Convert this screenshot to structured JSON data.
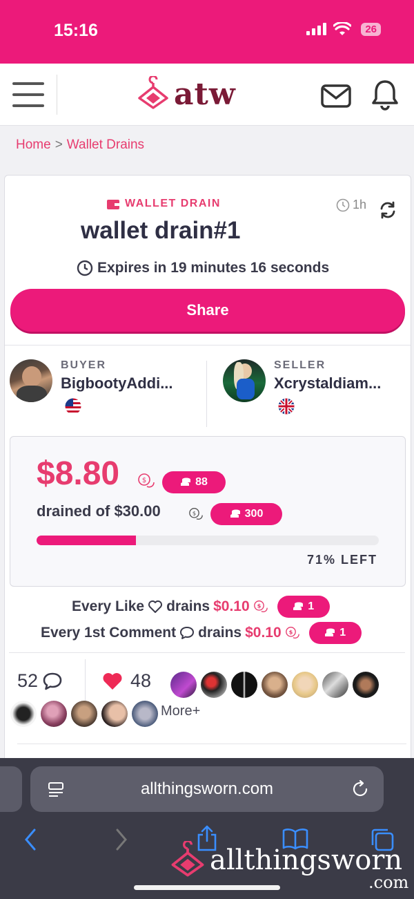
{
  "status": {
    "time": "15:16",
    "battery": "26"
  },
  "header": {
    "logo_text": "atw",
    "menu_icon": "hamburger-icon",
    "mail_icon": "mail-icon",
    "bell_icon": "bell-icon"
  },
  "breadcrumb": {
    "home": "Home",
    "sep": ">",
    "current": "Wallet Drains"
  },
  "listing": {
    "tag": "WALLET DRAIN",
    "title": "wallet drain#1",
    "age": "1h",
    "expires": "Expires in 19 minutes 16 seconds",
    "share_label": "Share"
  },
  "buyer": {
    "role": "BUYER",
    "name": "BigbootyAddi..."
  },
  "seller": {
    "role": "SELLER",
    "name": "Xcrystaldiam..."
  },
  "drain": {
    "amount": "$8.80",
    "amount_tokens": "88",
    "drained_text": "drained of $30.00",
    "total_tokens": "300",
    "progress_drained": 0.29,
    "left_label": "71% LEFT"
  },
  "rules": {
    "like_prefix": "Every Like",
    "like_middle": "drains",
    "like_amount": "$0.10",
    "like_tokens": "1",
    "comment_prefix": "Every 1st Comment",
    "comment_middle": "drains",
    "comment_amount": "$0.10",
    "comment_tokens": "1"
  },
  "stats": {
    "comments": "52",
    "likes": "48",
    "more_label": "More+"
  },
  "browser": {
    "url": "allthingsworn.com"
  },
  "watermark": {
    "text": "allthingsworn",
    "suffix": ".com"
  },
  "colors": {
    "brand_pink": "#ec1a7a",
    "accent_pink": "#e73c6f",
    "logo_maroon": "#7a1a36"
  }
}
